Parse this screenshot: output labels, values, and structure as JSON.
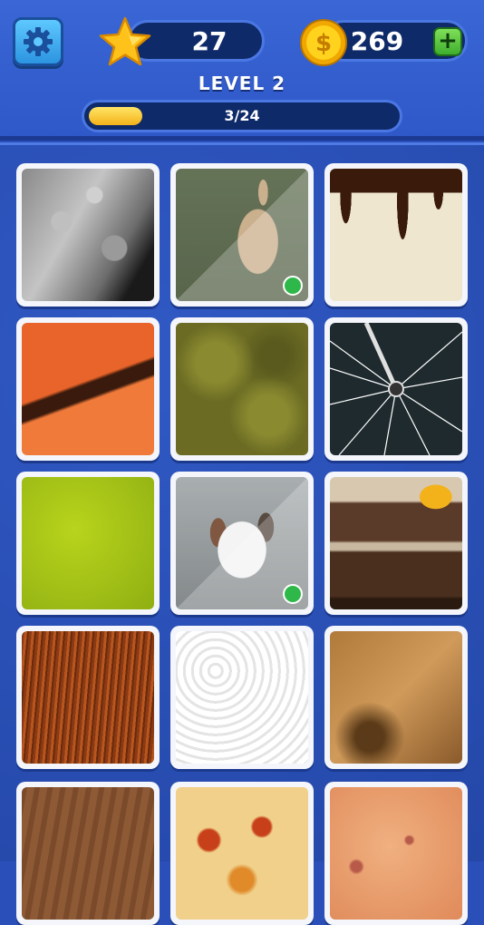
{
  "header": {
    "settings_icon": "gear-icon",
    "stars": "27",
    "coins": "269",
    "add_coins_label": "+",
    "level_title": "LEVEL 2",
    "progress_text": "3/24",
    "progress_fraction": 0.125
  },
  "tiles": [
    {
      "name": "moon surface",
      "solved": false
    },
    {
      "name": "rabbit",
      "solved": true
    },
    {
      "name": "chocolate drip",
      "solved": false
    },
    {
      "name": "carrot",
      "solved": false
    },
    {
      "name": "moss",
      "solved": false
    },
    {
      "name": "bicycle wheel spokes",
      "solved": false
    },
    {
      "name": "green felt",
      "solved": false
    },
    {
      "name": "dog",
      "solved": true
    },
    {
      "name": "burger patties",
      "solved": false
    },
    {
      "name": "red hair",
      "solved": false
    },
    {
      "name": "rice grains",
      "solved": false
    },
    {
      "name": "lion fur",
      "solved": false
    },
    {
      "name": "wood",
      "solved": false
    },
    {
      "name": "pizza",
      "solved": false
    },
    {
      "name": "orange speckled surface",
      "solved": false
    }
  ]
}
